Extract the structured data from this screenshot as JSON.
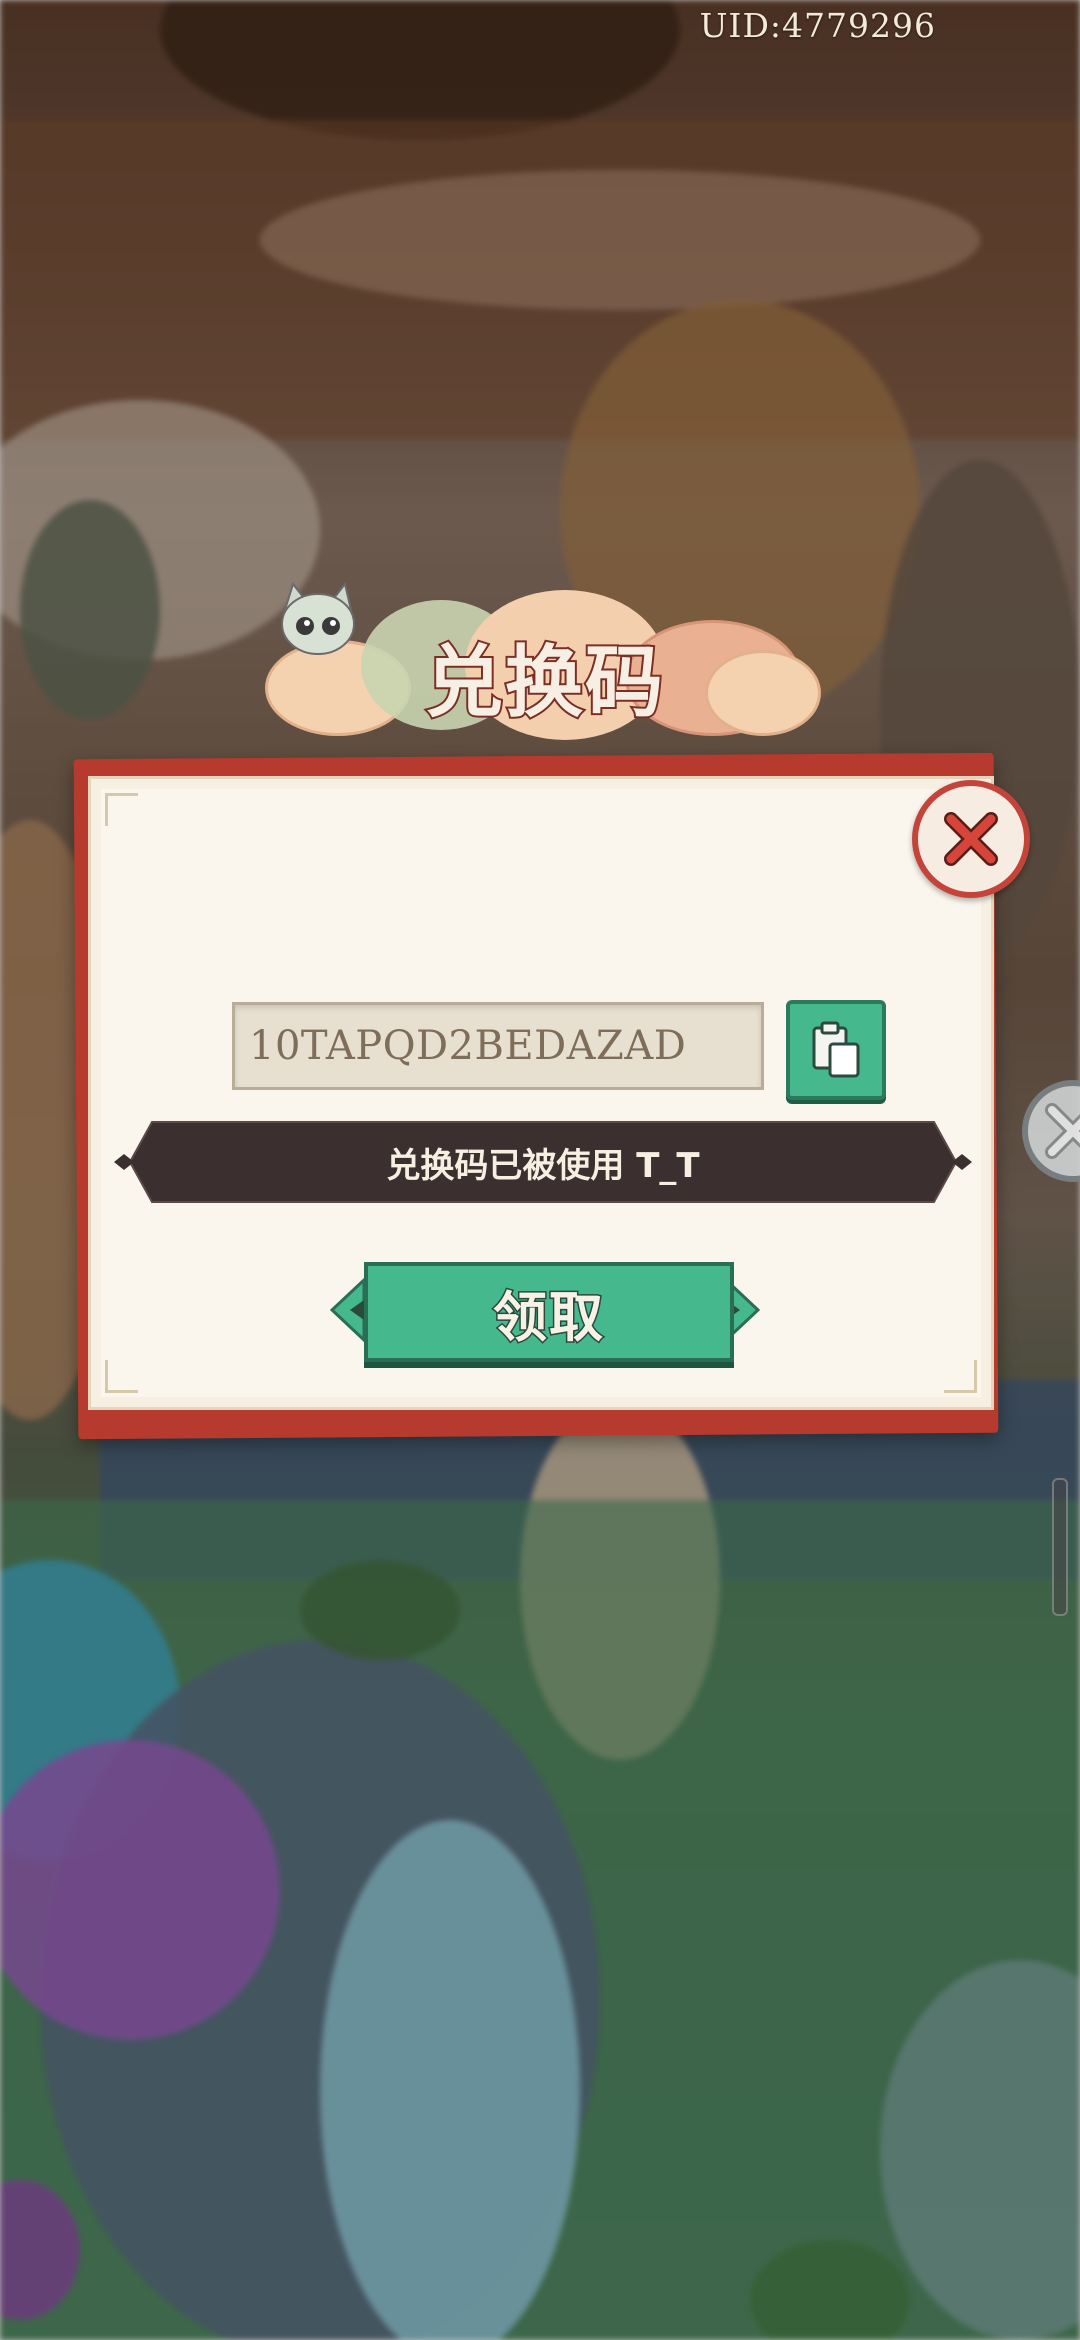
{
  "header": {
    "uid": "UID:4779296"
  },
  "dialog": {
    "title": "兑换码",
    "code_value": "10TAPQD2BEDAZAD",
    "message": "兑换码已被使用 T_T",
    "claim_label": "领取"
  },
  "icons": {
    "close": "close-icon",
    "paste": "clipboard-paste-icon",
    "mascot": "cat-mascot-icon"
  },
  "colors": {
    "accent_green": "#45b88e",
    "panel_red": "#b63a2e",
    "banner_dark": "#3b2f30",
    "title_stroke": "#7a2e24"
  }
}
